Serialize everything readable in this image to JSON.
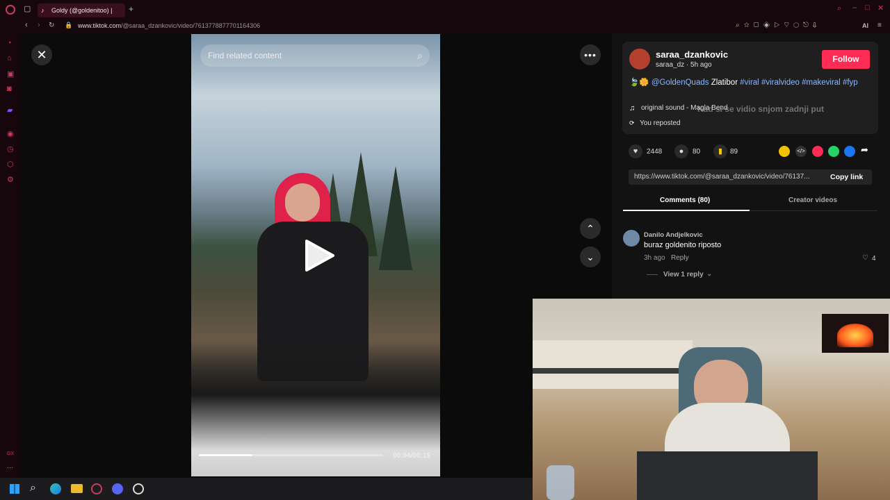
{
  "browser": {
    "tab_title": "Goldy (@goldenitoo) |",
    "url_host": "www.tiktok.com",
    "url_path": "/@saraa_dzankovic/video/7613778877701164306",
    "ai_label": "AI",
    "sidebar_bottom": "GX",
    "accent": "#d23a5a"
  },
  "video": {
    "search_placeholder": "Find related content",
    "time": "00:04/00:15",
    "progress": 0.29
  },
  "author": {
    "username": "saraa_dzankovic",
    "handle_time": "saraa_dz · 5h ago",
    "follow_label": "Follow"
  },
  "caption": {
    "emoji_text": "🍃🌼",
    "mention": "@GoldenQuads",
    "place": "Zlatibor",
    "tags": [
      "#viral",
      "#viralvideo",
      "#makeviral",
      "#fyp"
    ]
  },
  "sound": "original sound - Magla Bend",
  "overlay_subtitle": "Kad si se vidio snjom zadnji put",
  "reposted": "You reposted",
  "stats": {
    "likes": "2448",
    "comments": "80",
    "saves": "89"
  },
  "link": {
    "url": "https://www.tiktok.com/@saraa_dzankovic/video/76137...",
    "copy_label": "Copy link"
  },
  "tabs": {
    "comments": "Comments (80)",
    "creator": "Creator videos"
  },
  "comment": {
    "author": "Danilo Andjelkovic",
    "text": "buraz goldenito riposto",
    "time": "3h ago",
    "reply": "Reply",
    "likes": "4",
    "view_replies": "View 1 reply"
  }
}
